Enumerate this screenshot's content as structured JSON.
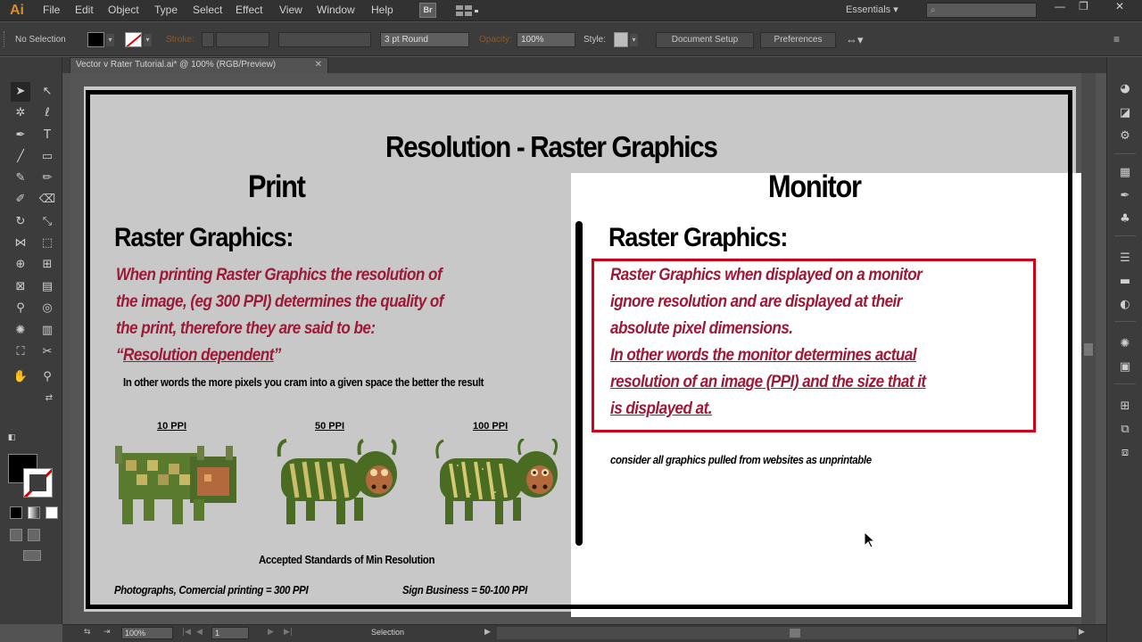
{
  "app": {
    "logo": "Ai",
    "menu": [
      "File",
      "Edit",
      "Object",
      "Type",
      "Select",
      "Effect",
      "View",
      "Window",
      "Help"
    ],
    "bridge_label": "Br",
    "workspace": "Essentials",
    "workspace_caret": "▾",
    "window_controls": [
      "—",
      "❐",
      "✕"
    ]
  },
  "control_bar": {
    "selection_status": "No Selection",
    "stroke_label": "Stroke:",
    "brush": "3 pt Round",
    "opacity_label": "Opacity:",
    "opacity_value": "100%",
    "style_label": "Style:",
    "document_setup": "Document Setup",
    "preferences": "Preferences"
  },
  "document_tab": {
    "title": "Vector v Rater Tutorial.ai* @ 100% (RGB/Preview)",
    "close": "✕"
  },
  "status_bar": {
    "zoom": "100%",
    "artboard": "1",
    "tool": "Selection"
  },
  "slide": {
    "title": "Resolution - Raster Graphics",
    "print": {
      "heading": "Print",
      "subheading": "Raster Graphics:",
      "lines": [
        "When printing Raster Graphics the resolution of",
        "the image, (eg 300 PPI) determines the quality of",
        "the print, therefore they are said to be:"
      ],
      "quote_open": "“",
      "quote_term": "Resolution dependent",
      "quote_close": "”",
      "note": "In other words the more pixels you cram into a given space the better the result",
      "ppi_labels": [
        "10 PPI",
        "50 PPI",
        "100 PPI"
      ],
      "standards_title": "Accepted Standards of Min Resolution",
      "standard_photos": "Photographs, Comercial printing = 300 PPI",
      "standard_signs": "Sign Business = 50-100 PPI"
    },
    "monitor": {
      "heading": "Monitor",
      "subheading": "Raster Graphics:",
      "lines": [
        "Raster Graphics when displayed on a monitor",
        "ignore resolution and are displayed at their",
        "absolute pixel dimensions."
      ],
      "underlined_lines": [
        "In other words the monitor determines actual",
        "resolution of an image (PPI) and the size that it",
        "is displayed at."
      ],
      "note": "consider all graphics pulled from websites as unprintable"
    }
  },
  "colors": {
    "accent_red_text": "#9c1a38",
    "highlight_box": "#d0021b",
    "ui_dark": "#323232"
  }
}
